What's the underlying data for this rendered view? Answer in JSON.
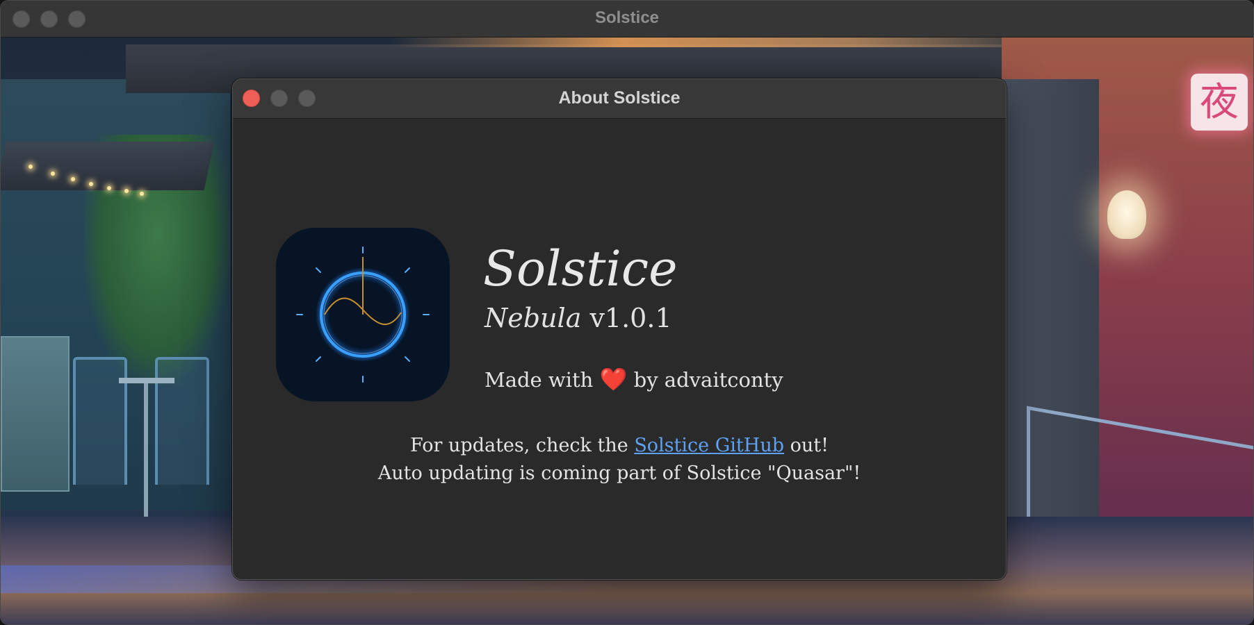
{
  "main_window": {
    "title": "Solstice"
  },
  "wallpaper": {
    "sign_glyph": "夜"
  },
  "about_window": {
    "title": "About Solstice",
    "app_name": "Solstice",
    "version_codename": "Nebula",
    "version_number": "v1.0.1",
    "credit_prefix": "Made with",
    "credit_heart": "❤️",
    "credit_suffix": "by advaitconty",
    "updates_line1_prefix": "For updates, check the",
    "updates_link": "Solstice GitHub",
    "updates_line1_suffix": "out!",
    "updates_line2": "Auto updating is coming part of Solstice \"Quasar\"!"
  },
  "colors": {
    "close_button": "#ee5f57",
    "link": "#5ea2f5",
    "icon_background": "#061426",
    "icon_ring": "#3aa0ff",
    "icon_wave": "#c8902e"
  },
  "icons": {
    "app_icon": "clock-sine-wave-icon"
  }
}
